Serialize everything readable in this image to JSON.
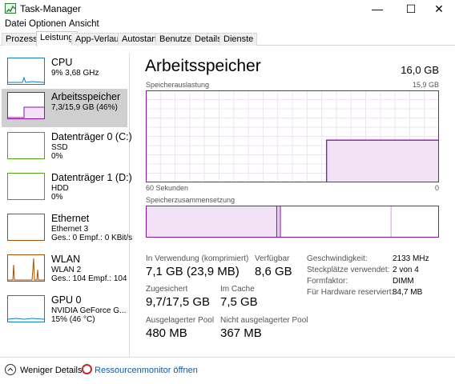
{
  "window": {
    "title": "Task-Manager",
    "minimize_glyph": "—",
    "maximize_glyph": "☐",
    "close_glyph": "✕"
  },
  "menu": [
    "Datei",
    "Optionen",
    "Ansicht"
  ],
  "tabs": [
    "Prozesse",
    "Leistung",
    "App-Verlauf",
    "Autostart",
    "Benutzer",
    "Details",
    "Dienste"
  ],
  "active_tab": "Leistung",
  "sidebar": {
    "items": [
      {
        "name": "CPU",
        "line1": "9% 3,68 GHz",
        "line2": "",
        "color": "#117dbb"
      },
      {
        "name": "Arbeitsspeicher",
        "line1": "7,3/15,9 GB (46%)",
        "line2": "",
        "color": "#8b12ae"
      },
      {
        "name": "Datenträger 0 (C:)",
        "line1": "SSD",
        "line2": "0%",
        "color": "#4da60c"
      },
      {
        "name": "Datenträger 1 (D:)",
        "line1": "HDD",
        "line2": "0%",
        "color": "#4da60c"
      },
      {
        "name": "Ethernet",
        "line1": "Ethernet 3",
        "line2": "Ges.: 0  Empf.: 0 KBit/s",
        "color": "#a74f01"
      },
      {
        "name": "WLAN",
        "line1": "WLAN 2",
        "line2": "Ges.: 104  Empf.: 104 KBit/s",
        "color": "#a74f01"
      },
      {
        "name": "GPU 0",
        "line1": "NVIDIA GeForce G...",
        "line2": "15% (46 °C)",
        "color": "#117dbb"
      }
    ]
  },
  "main": {
    "title": "Arbeitsspeicher",
    "total": "16,0 GB",
    "usage_label": "Speicherauslastung",
    "usage_max": "15,9 GB",
    "axis_left": "60 Sekunden",
    "axis_right": "0",
    "composition_label": "Speicherzusammensetzung"
  },
  "stats": {
    "in_use_label": "In Verwendung (komprimiert)",
    "in_use_value": "7,1 GB (23,9 MB)",
    "available_label": "Verfügbar",
    "available_value": "8,6 GB",
    "committed_label": "Zugesichert",
    "committed_value": "9,7/17,5 GB",
    "cached_label": "Im Cache",
    "cached_value": "7,5 GB",
    "paged_label": "Ausgelagerter Pool",
    "paged_value": "480 MB",
    "nonpaged_label": "Nicht ausgelagerter Pool",
    "nonpaged_value": "367 MB"
  },
  "properties": [
    {
      "label": "Geschwindigkeit:",
      "value": "2133 MHz"
    },
    {
      "label": "Steckplätze verwendet:",
      "value": "2 von 4"
    },
    {
      "label": "Formfaktor:",
      "value": "DIMM"
    },
    {
      "label": "Für Hardware reserviert:",
      "value": "84,7 MB"
    }
  ],
  "footer": {
    "fewer_details": "Weniger Details",
    "resource_monitor": "Ressourcenmonitor öffnen"
  },
  "colors": {
    "memory_accent": "#8b12ae",
    "memory_fill": "#f1e3f5",
    "link": "#0b5cad"
  },
  "chart_data": {
    "type": "area",
    "series": [
      {
        "values": [
          0,
          0,
          0,
          0,
          0,
          0,
          0,
          0,
          0,
          0,
          0,
          0,
          0,
          0,
          0,
          0,
          0,
          0,
          0,
          0,
          0,
          0,
          0,
          0,
          0,
          0,
          0,
          0,
          0,
          0,
          0,
          0,
          0,
          0,
          0,
          0,
          0,
          7.3,
          7.3,
          7.3,
          7.3,
          7.3,
          7.3,
          7.3,
          7.3,
          7.3,
          7.3,
          7.3,
          7.3,
          7.3,
          7.3,
          7.3,
          7.3,
          7.3,
          7.3,
          7.3,
          7.3,
          7.3,
          7.3,
          7.3,
          7.3
        ]
      }
    ],
    "xlim": [
      60,
      0
    ],
    "ylim": [
      0,
      15.9
    ],
    "grid": true,
    "composition": {
      "in_use": 7.1,
      "modified": 0.2,
      "standby": 6.0,
      "free": 2.6
    }
  }
}
